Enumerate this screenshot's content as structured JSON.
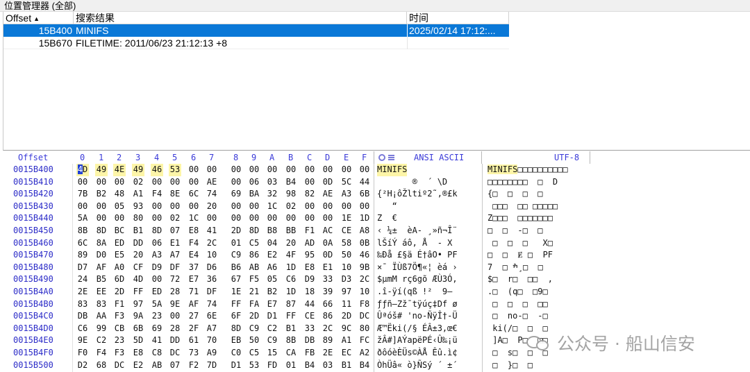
{
  "panel": {
    "title": "位置管理器 (全部)",
    "columns": {
      "offset": "Offset",
      "result": "搜索结果",
      "time": "时间"
    },
    "rows": [
      {
        "offset": "15B400",
        "result": "MINIFS",
        "time": "2025/02/14  17:12:...",
        "selected": true
      },
      {
        "offset": "15B670",
        "result": "FILETIME: 2011/06/23  21:12:13  +8",
        "time": "",
        "selected": false
      }
    ]
  },
  "hex": {
    "header": {
      "offset": "Offset",
      "cols": [
        "0",
        "1",
        "2",
        "3",
        "4",
        "5",
        "6",
        "7",
        "8",
        "9",
        "A",
        "B",
        "C",
        "D",
        "E",
        "F"
      ],
      "ansi": "ANSI ASCII",
      "utf": "UTF-8"
    },
    "rows": [
      {
        "off": "0015B400",
        "bytes": [
          "4D",
          "49",
          "4E",
          "49",
          "46",
          "53",
          "00",
          "00",
          "00",
          "00",
          "00",
          "00",
          "00",
          "00",
          "00",
          "00"
        ],
        "ansi": "MINIFS",
        "utf": "MINIFS□□□□□□□□□□"
      },
      {
        "off": "0015B410",
        "bytes": [
          "00",
          "00",
          "00",
          "02",
          "00",
          "00",
          "00",
          "AE",
          "00",
          "06",
          "03",
          "B4",
          "00",
          "0D",
          "5C",
          "44"
        ],
        "ansi": "       ®  ´ \\D",
        "utf": "□□□□□□□□  □  D"
      },
      {
        "off": "0015B420",
        "bytes": [
          "7B",
          "B2",
          "48",
          "A1",
          "F4",
          "8E",
          "6C",
          "74",
          "69",
          "BA",
          "32",
          "98",
          "82",
          "AE",
          "A3",
          "6B"
        ],
        "ansi": "{²H¡ôŽltiº2˜‚®£k",
        "utf": "{□  □  □  □"
      },
      {
        "off": "0015B430",
        "bytes": [
          "00",
          "00",
          "05",
          "93",
          "00",
          "00",
          "00",
          "20",
          "00",
          "00",
          "1C",
          "02",
          "00",
          "00",
          "00",
          "00"
        ],
        "ansi": "   “",
        "utf": " □□□  □□ □□□□□"
      },
      {
        "off": "0015B440",
        "bytes": [
          "5A",
          "00",
          "00",
          "80",
          "00",
          "02",
          "1C",
          "00",
          "00",
          "00",
          "00",
          "00",
          "00",
          "00",
          "1E",
          "1D"
        ],
        "ansi": "Z  €",
        "utf": "Z□□□  □□□□□□□"
      },
      {
        "off": "0015B450",
        "bytes": [
          "8B",
          "8D",
          "BC",
          "B1",
          "8D",
          "07",
          "E8",
          "41",
          "2D",
          "8D",
          "B8",
          "BB",
          "F1",
          "AC",
          "CE",
          "A8"
        ],
        "ansi": "‹ ¼±  èA- ¸»ñ¬Î¨",
        "utf": "□  □  -□  □"
      },
      {
        "off": "0015B460",
        "bytes": [
          "6C",
          "8A",
          "ED",
          "DD",
          "06",
          "E1",
          "F4",
          "2C",
          "01",
          "C5",
          "04",
          "20",
          "AD",
          "0A",
          "58",
          "0B"
        ],
        "ansi": "lŠíÝ áô, Å  - X",
        "utf": " □  □  □   X□"
      },
      {
        "off": "0015B470",
        "bytes": [
          "89",
          "D0",
          "E5",
          "20",
          "A3",
          "A7",
          "E4",
          "10",
          "C9",
          "86",
          "E2",
          "4F",
          "95",
          "0D",
          "50",
          "46"
        ],
        "ansi": "‰Ðå £§ä É†âO• PF",
        "utf": "□  □  Ɇ □  PF"
      },
      {
        "off": "0015B480",
        "bytes": [
          "D7",
          "AF",
          "A0",
          "CF",
          "D9",
          "DF",
          "37",
          "D6",
          "B6",
          "AB",
          "A6",
          "1D",
          "E8",
          "E1",
          "10",
          "9B"
        ],
        "ansi": "×¯ ÏÙß7Ö¶«¦ èá ›",
        "utf": "ׯ □  7 ̧□  □"
      },
      {
        "off": "0015B490",
        "bytes": [
          "24",
          "B5",
          "6D",
          "4D",
          "00",
          "72",
          "E7",
          "36",
          "67",
          "F5",
          "05",
          "C6",
          "D9",
          "33",
          "D3",
          "2C"
        ],
        "ansi": "$µmM rç6gõ ÆÙ3Ó,",
        "utf": "$□  r□  □□  ,"
      },
      {
        "off": "0015B4A0",
        "bytes": [
          "2E",
          "EE",
          "2D",
          "FF",
          "ED",
          "28",
          "71",
          "DF",
          "1E",
          "21",
          "B2",
          "1D",
          "18",
          "39",
          "97",
          "10"
        ],
        "ansi": ".î-ÿí(qß !²  9— ",
        "utf": ".□  (q□  □9□"
      },
      {
        "off": "0015B4B0",
        "bytes": [
          "83",
          "83",
          "F1",
          "97",
          "5A",
          "9E",
          "AF",
          "74",
          "FF",
          "FA",
          "E7",
          "87",
          "44",
          "66",
          "11",
          "F8"
        ],
        "ansi": "ƒƒñ—Zž¯tÿúç‡Df ø",
        "utf": " □  □  □  □□"
      },
      {
        "off": "0015B4C0",
        "bytes": [
          "DB",
          "AA",
          "F3",
          "9A",
          "23",
          "00",
          "27",
          "6E",
          "6F",
          "2D",
          "D1",
          "FF",
          "CE",
          "86",
          "2D",
          "DC"
        ],
        "ansi": "Ûªóš# 'no-ÑÿÎ†-Ü",
        "utf": " □  no-□  -□"
      },
      {
        "off": "0015B4D0",
        "bytes": [
          "C6",
          "99",
          "CB",
          "6B",
          "69",
          "28",
          "2F",
          "A7",
          "8D",
          "C9",
          "C2",
          "B1",
          "33",
          "2C",
          "9C",
          "80"
        ],
        "ansi": "Æ™Ëki(/§ ÉÂ±3,œ€",
        "utf": " ki(/□  □  □"
      },
      {
        "off": "0015B4E0",
        "bytes": [
          "9E",
          "C2",
          "23",
          "5D",
          "41",
          "DD",
          "61",
          "70",
          "EB",
          "50",
          "C9",
          "8B",
          "DB",
          "89",
          "A1",
          "FC"
        ],
        "ansi": "žÂ#]AÝapëPÉ‹Û‰¡ü",
        "utf": " ]A□  P□  □□"
      },
      {
        "off": "0015B4F0",
        "bytes": [
          "F0",
          "F4",
          "F3",
          "E8",
          "C8",
          "DC",
          "73",
          "A9",
          "C0",
          "C5",
          "15",
          "CA",
          "FB",
          "2E",
          "EC",
          "A2"
        ],
        "ansi": "ðôóèÈÜs©ÀÅ Êû.ì¢",
        "utf": " □  s□  □  □"
      },
      {
        "off": "0015B500",
        "bytes": [
          "D2",
          "68",
          "DC",
          "E2",
          "AB",
          "07",
          "F2",
          "7D",
          "D1",
          "53",
          "FD",
          "01",
          "B4",
          "03",
          "B1",
          "B4"
        ],
        "ansi": "ÒhÜâ« ò}ÑSý ´ ±´",
        "utf": " □  }□  □"
      }
    ]
  },
  "watermark": {
    "text": "公众号 · 船山信安"
  }
}
